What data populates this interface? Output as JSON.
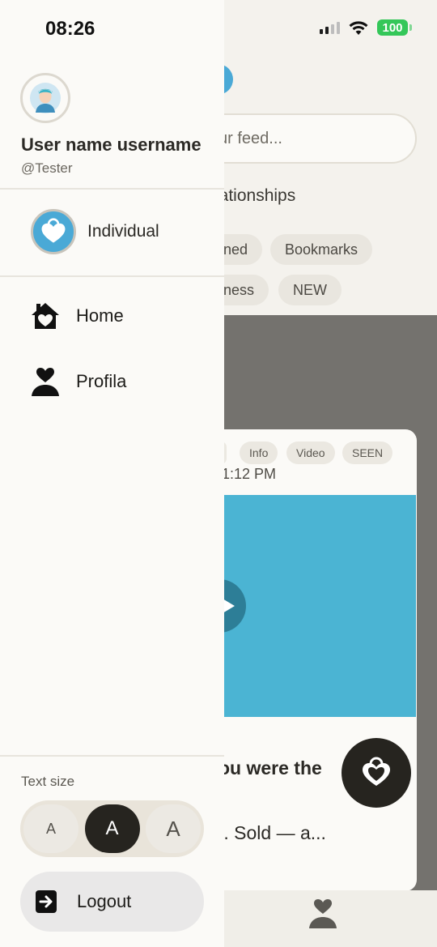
{
  "status_bar": {
    "time": "08:26",
    "battery": "100"
  },
  "profile": {
    "name": "User name username",
    "handle": "@Tester"
  },
  "account": {
    "label": "Individual"
  },
  "nav": [
    {
      "label": "Home",
      "icon": "home-heart-icon"
    },
    {
      "label": "Profila",
      "icon": "profile-heart-icon"
    }
  ],
  "text_size": {
    "label": "Text size",
    "options": [
      "A",
      "A",
      "A"
    ],
    "selected_index": 1
  },
  "logout": {
    "label": "Logout",
    "icon": "logout-icon"
  },
  "feed": {
    "search_placeholder": "ur feed...",
    "section_title": "lationships",
    "chips": [
      "ned",
      "Bookmarks",
      "ness",
      "NEW"
    ],
    "card": {
      "tags": [
        "Info",
        "Video",
        "SEEN"
      ],
      "time": "1:12 PM",
      "title": "ou were the",
      "snippet": "t. Sold — a..."
    }
  },
  "colors": {
    "accent_blue": "#4aa9d6",
    "dark": "#26241f",
    "battery_green": "#34c759"
  }
}
